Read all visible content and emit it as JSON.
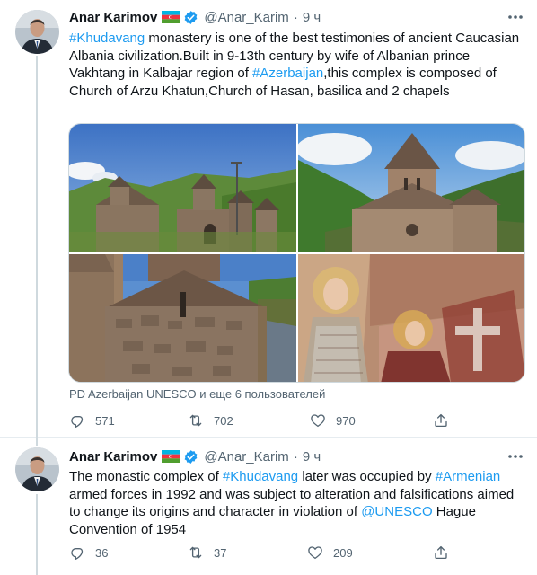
{
  "tweets": [
    {
      "author": {
        "name": "Anar Karimov",
        "handle": "@Anar_Karim",
        "flag_icon": "azerbaijan-flag-icon",
        "verified_icon": "verified-badge-icon"
      },
      "separator": "·",
      "time": "9 ч",
      "text_parts": [
        {
          "t": "#Khudavang",
          "link": true
        },
        {
          "t": " monastery is one of the best testimonies of ancient Caucasian Albania civilization.Built in 9-13th century by wife of Albanian prince Vakhtang in Kalbajar region of ",
          "link": false
        },
        {
          "t": "#Azerbaijan",
          "link": true
        },
        {
          "t": ",this complex is composed of Church of Arzu Khatun,Church of Hasan, basilica and 2 chapels",
          "link": false
        }
      ],
      "tagged_line": "PD Azerbaijan UNESCO и еще 6 пользователей",
      "counts": {
        "replies": "571",
        "retweets": "702",
        "likes": "970"
      }
    },
    {
      "author": {
        "name": "Anar Karimov",
        "handle": "@Anar_Karim",
        "flag_icon": "azerbaijan-flag-icon",
        "verified_icon": "verified-badge-icon"
      },
      "separator": "·",
      "time": "9 ч",
      "text_parts": [
        {
          "t": "The monastic complex of ",
          "link": false
        },
        {
          "t": "#Khudavang",
          "link": true
        },
        {
          "t": " later was occupied by ",
          "link": false
        },
        {
          "t": "#Armenian",
          "link": true
        },
        {
          "t": " armed forces in 1992 and was subject to alteration and falsifications aimed to change its origins and character in violation of ",
          "link": false
        },
        {
          "t": "@UNESCO",
          "link": true
        },
        {
          "t": " Hague Convention of 1954",
          "link": false
        }
      ],
      "counts": {
        "replies": "36",
        "retweets": "37",
        "likes": "209"
      }
    }
  ],
  "icons": {
    "reply": "reply-icon",
    "retweet": "retweet-icon",
    "like": "heart-icon",
    "share": "share-icon",
    "more": "more-options-icon"
  },
  "colors": {
    "link": "#1d9bf0",
    "secondary_text": "#536471",
    "verified": "#1d9bf0",
    "thread_line": "#cfd9de"
  }
}
